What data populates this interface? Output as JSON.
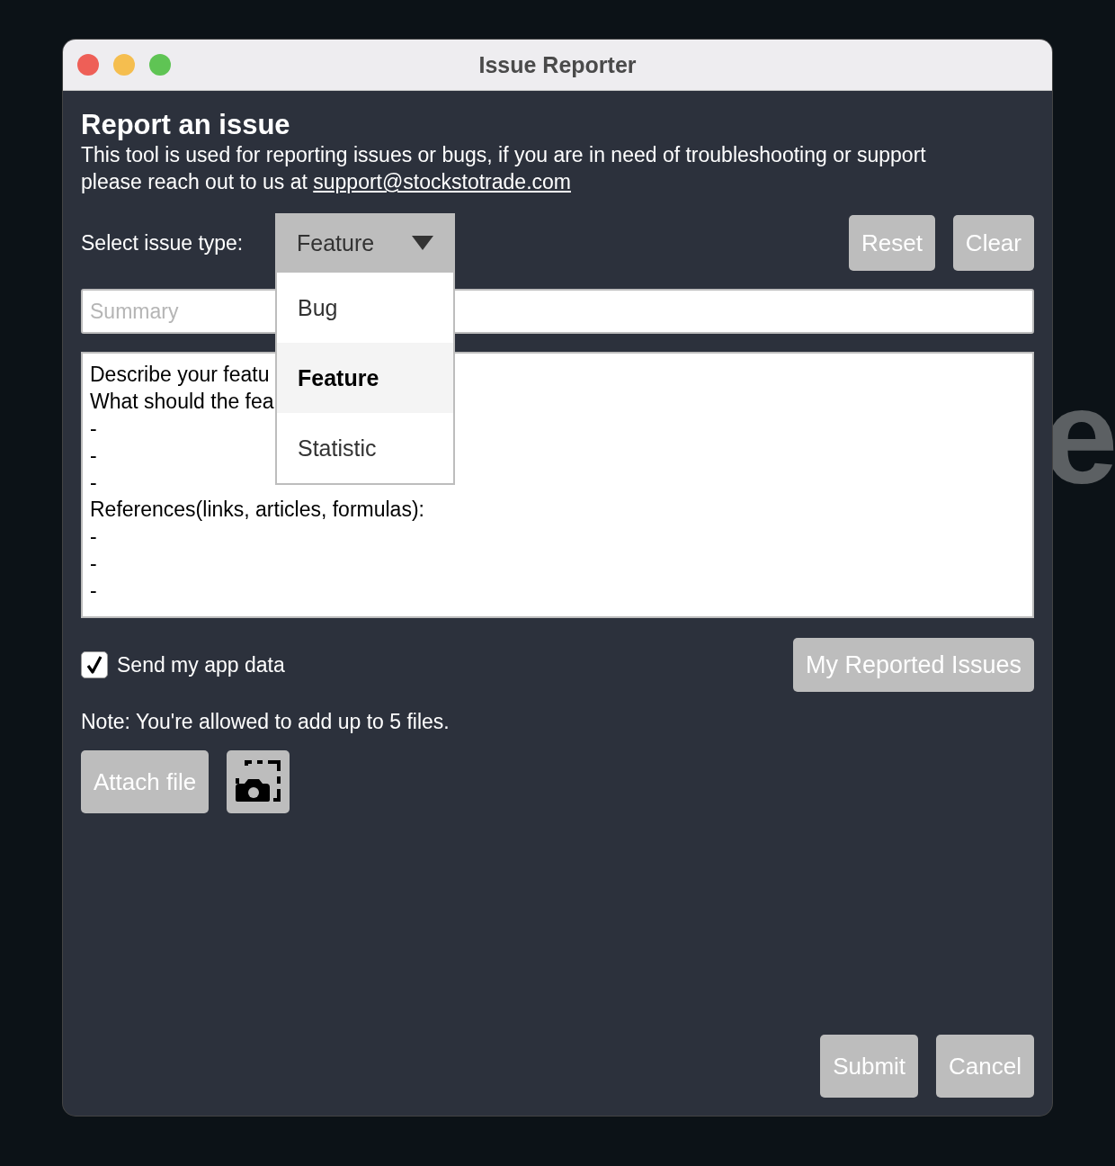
{
  "background_text": "e",
  "window": {
    "title": "Issue Reporter"
  },
  "heading": "Report an issue",
  "description": {
    "text": "This tool is used for reporting issues or bugs, if you are in need of troubleshooting or support please reach out to us at ",
    "link": "support@stockstotrade.com"
  },
  "issue_type": {
    "label": "Select issue type:",
    "value": "Feature",
    "expanded": true,
    "options": [
      {
        "label": "Bug",
        "selected": false
      },
      {
        "label": "Feature",
        "selected": true
      },
      {
        "label": "Statistic",
        "selected": false
      }
    ]
  },
  "top_buttons": [
    "Reset",
    "Clear"
  ],
  "summary": {
    "placeholder": "Summary"
  },
  "details": {
    "lines": [
      "Describe your featu",
      "What should the fea",
      "-",
      "-",
      "-",
      "References(links, articles, formulas):",
      "-",
      "-",
      "-"
    ]
  },
  "send_app_data": {
    "label": "Send my app data",
    "checked": true
  },
  "reported_issues_button": "My Reported Issues",
  "note": "Note: You're allowed to add up to 5 files.",
  "attach_button": "Attach file",
  "bottom_buttons": [
    "Submit",
    "Cancel"
  ]
}
